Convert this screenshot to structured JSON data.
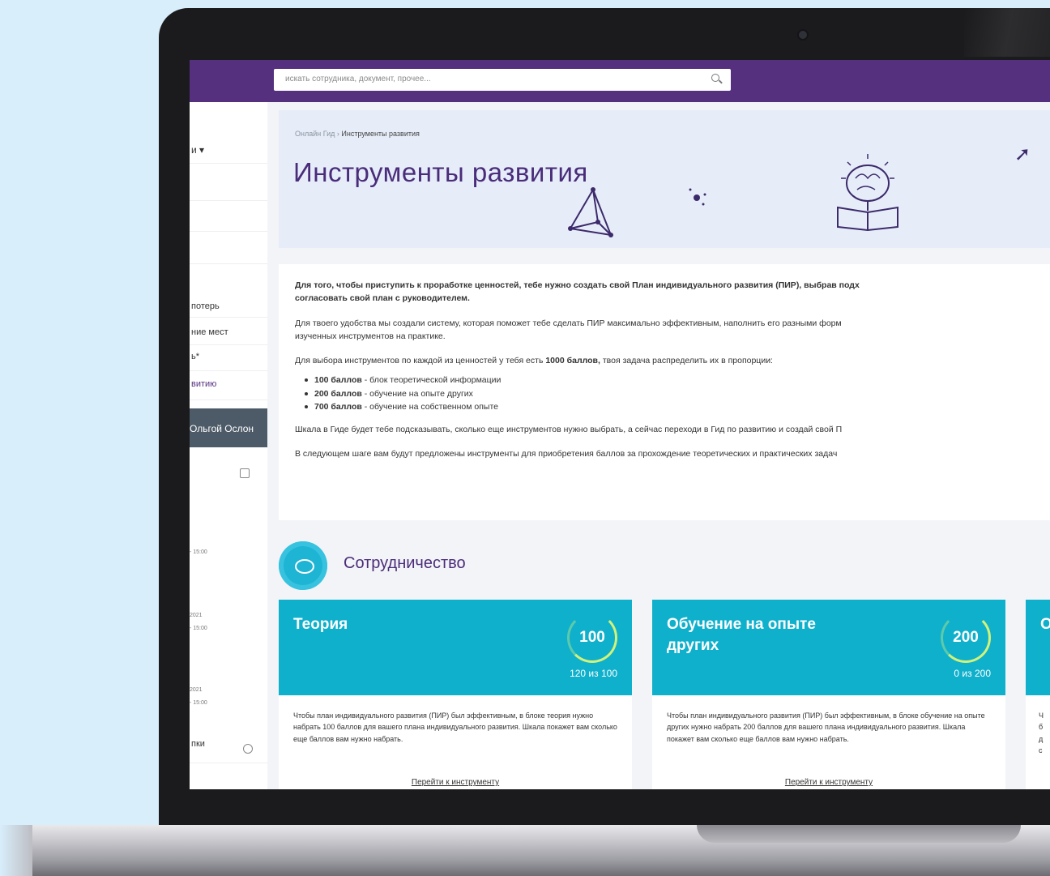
{
  "search": {
    "placeholder": "искать сотрудника, документ, прочее..."
  },
  "sidebar": {
    "rows": [
      "и ▾",
      "потерь",
      "ние мест",
      "ь*",
      "витию"
    ],
    "active_row": "Ольгой Ослон",
    "times": [
      "- 15:00",
      "2021",
      "- 15:00",
      "2021",
      "- 15:00"
    ],
    "bottom": "пки"
  },
  "breadcrumb": {
    "home": "Онлайн Гид",
    "sep": "›",
    "current": "Инструменты развития"
  },
  "page": {
    "title": "Инструменты развития"
  },
  "intro": {
    "p1a": "Для того, чтобы приступить к проработке ценностей, тебе нужно создать свой План индивидуального развития (ПИР), выбрав подх",
    "p1b": "согласовать свой план с руководителем.",
    "p2a": "Для твоего удобства мы создали систему, которая поможет тебе сделать ПИР максимально эффективным, наполнить его разными форм",
    "p2b": "изученных инструментов на практике.",
    "p3_pre": "Для выбора инструментов по каждой из ценностей у тебя есть ",
    "p3_bold": "1000 баллов,",
    "p3_post": " твоя задача распределить их в пропорции:",
    "items": [
      {
        "bold": "100 баллов",
        "text": " - блок теоретической информации"
      },
      {
        "bold": "200 баллов",
        "text": " - обучение на опыте других"
      },
      {
        "bold": "700 баллов",
        "text": " - обучение на собственном опыте"
      }
    ],
    "p4": "Шкала в Гиде будет тебе подсказывать, сколько еще инструментов нужно выбрать, а сейчас переходи в Гид по развитию и создай свой П",
    "p5": "В следующем шаге вам будут предложены инструменты для приобретения баллов за прохождение теоретических и практических задач"
  },
  "section": {
    "title": "Сотрудничество",
    "icon": "cooperation-icon"
  },
  "cards": [
    {
      "title": "Теория",
      "points": "100",
      "progress": "120 из 100",
      "body": "Чтобы план индивидуального развития (ПИР) был эффективным, в блоке теория нужно набрать 100 баллов для вашего плана индивидуального развития. Шкала покажет вам сколько еще баллов вам нужно набрать.",
      "link": "Перейти к инструменту"
    },
    {
      "title": "Обучение на опыте других",
      "points": "200",
      "progress": "0 из 200",
      "body": "Чтобы план индивидуального развития (ПИР) был эффективным, в блоке обучение на опыте других нужно набрать 200 баллов для вашего плана индивидуального развития. Шкала покажет вам сколько еще баллов вам нужно набрать.",
      "link": "Перейти к инструменту"
    },
    {
      "title": "О с",
      "body": "Ч б д с"
    }
  ],
  "colors": {
    "brand": "#55307e",
    "accent": "#0fb0cc",
    "ring": "#d2f27a"
  }
}
